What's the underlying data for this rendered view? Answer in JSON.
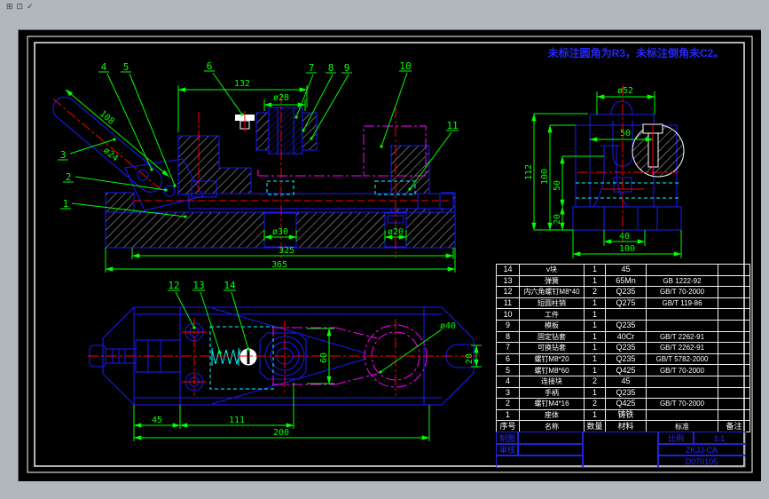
{
  "chrome": {
    "icons": [
      "⊞",
      "⊡",
      "✓"
    ]
  },
  "note": "未标注圆角为R3，未标注倒角未C2。",
  "colors": {
    "line_blue": "#1a1aff",
    "dim_green": "#00ff00",
    "center_red": "#ff0000",
    "hidden_cyan": "#00ffff",
    "phantom_magenta": "#ff00ff",
    "frame_white": "#ffffff",
    "title_blue": "#2a2aff"
  },
  "front_view": {
    "balloons": [
      "1",
      "2",
      "3",
      "4",
      "5",
      "6",
      "7",
      "8",
      "9",
      "10",
      "11"
    ],
    "dims": {
      "width_132": "132",
      "dia_28": "ø28",
      "len_108": "108",
      "dia_24": "ø24",
      "dia_30": "ø30",
      "dia_20": "ø20",
      "len_325": "325",
      "len_365": "365"
    }
  },
  "side_view": {
    "dims": {
      "dia_52": "ø52",
      "len_50": "50",
      "h_112": "112",
      "h_100": "100",
      "h_50": "50",
      "h_20": "20",
      "w_40": "40",
      "w_100": "100"
    }
  },
  "top_view": {
    "balloons": [
      "12",
      "13",
      "14"
    ],
    "dims": {
      "w_45": "45",
      "w_111": "111",
      "w_200": "200",
      "h_60": "60",
      "dia_40": "ø40",
      "h_20": "20"
    }
  },
  "bom": {
    "headers": [
      "序号",
      "名称",
      "数量",
      "材料",
      "标准",
      "备注"
    ],
    "rows": [
      [
        "14",
        "v块",
        "1",
        "45",
        "",
        ""
      ],
      [
        "13",
        "弹簧",
        "1",
        "65Mn",
        "GB 1222-92",
        ""
      ],
      [
        "12",
        "内六角螺钉M8*40",
        "2",
        "Q235",
        "GB/T 70-2000",
        ""
      ],
      [
        "11",
        "短圆柱销",
        "1",
        "Q275",
        "GB/T 119-86",
        ""
      ],
      [
        "10",
        "工件",
        "1",
        "",
        "",
        ""
      ],
      [
        "9",
        "模板",
        "1",
        "Q235",
        "",
        ""
      ],
      [
        "8",
        "固定钻套",
        "1",
        "40Cr",
        "GB/T 2262-91",
        ""
      ],
      [
        "7",
        "可换钻套",
        "1",
        "Q235",
        "GB/T 2262-91",
        ""
      ],
      [
        "6",
        "螺钉M8*20",
        "1",
        "Q235",
        "GB/T 5782-2000",
        ""
      ],
      [
        "5",
        "螺钉M8*60",
        "1",
        "Q425",
        "GB/T 70-2000",
        ""
      ],
      [
        "4",
        "连接块",
        "2",
        "45",
        "",
        ""
      ],
      [
        "3",
        "手柄",
        "1",
        "Q235",
        "",
        ""
      ],
      [
        "2",
        "螺钉M4*16",
        "2",
        "Q425",
        "GB/T 70-2000",
        ""
      ],
      [
        "1",
        "座体",
        "1",
        "铸铁",
        "",
        ""
      ]
    ]
  },
  "title_block": {
    "draw_label": "制图",
    "check_label": "审核",
    "scale_label": "比例",
    "scale_value": "1:1",
    "code": "ZKJJ-CA",
    "number": "D070105"
  }
}
